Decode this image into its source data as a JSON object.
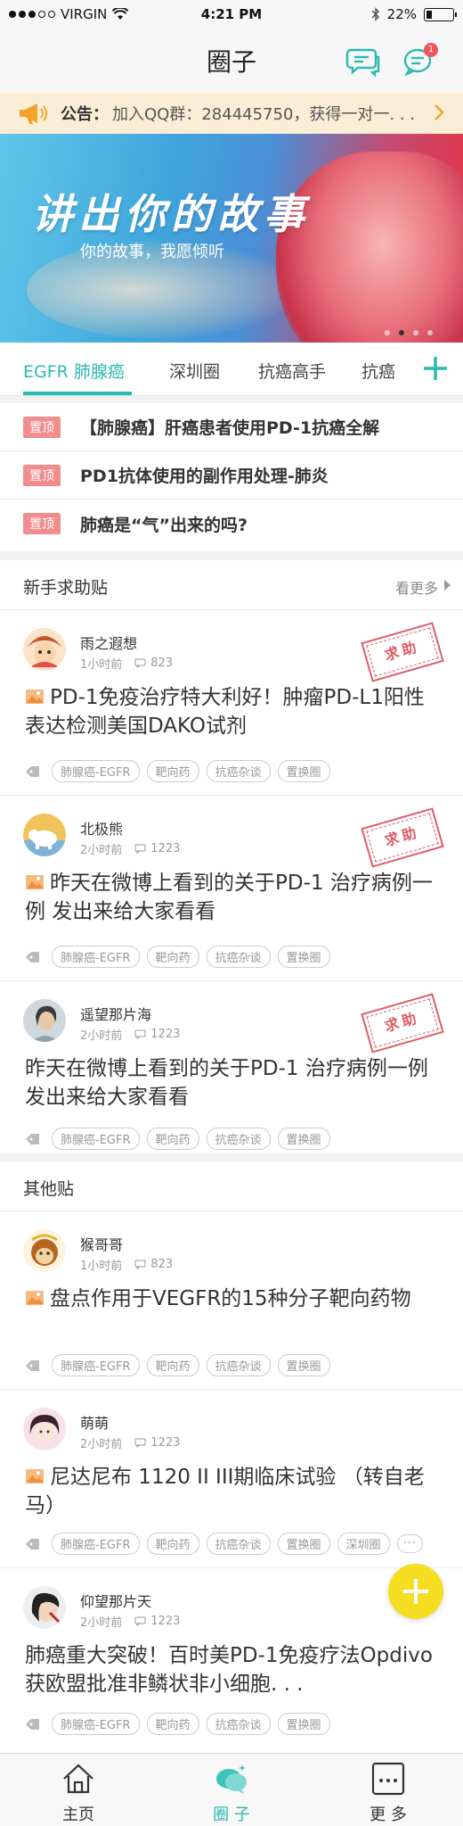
{
  "status": {
    "carrier": "VIRGIN",
    "time": "4:21 PM",
    "battery": "22%"
  },
  "nav": {
    "title": "圈子",
    "message_badge": "1"
  },
  "notice": {
    "label": "公告：",
    "text": "加入QQ群：284445750，获得一对一. . ."
  },
  "banner": {
    "headline": "讲出你的故事",
    "subtitle": "你的故事，我愿倾听"
  },
  "tabs": [
    "EGFR 肺腺癌",
    "深圳圈",
    "抗癌高手",
    "抗癌"
  ],
  "pinned": {
    "tag": "置顶",
    "items": [
      "【肺腺癌】肝癌患者使用PD-1抗癌全解",
      "PD1抗体使用的副作用处理-肺炎",
      "肺癌是“气”出来的吗?"
    ]
  },
  "newbie": {
    "title": "新手求助贴",
    "more": "看更多",
    "stamp": "求助",
    "posts": [
      {
        "user": "雨之遐想",
        "time": "1小时前",
        "comments": "823",
        "title": "PD-1免疫治疗特大利好！肿瘤PD-L1阳性表达检测美国DAKO试剂",
        "tags": [
          "肺腺癌-EGFR",
          "靶向药",
          "抗癌杂谈",
          "置换圈"
        ]
      },
      {
        "user": "北极熊",
        "time": "2小时前",
        "comments": "1223",
        "title": "昨天在微博上看到的关于PD-1 治疗病例一例 发出来给大家看看",
        "tags": [
          "肺腺癌-EGFR",
          "靶向药",
          "抗癌杂谈",
          "置换圈"
        ]
      },
      {
        "user": "遥望那片海",
        "time": "2小时前",
        "comments": "1223",
        "title": "昨天在微博上看到的关于PD-1 治疗病例一例 发出来给大家看看",
        "tags": [
          "肺腺癌-EGFR",
          "靶向药",
          "抗癌杂谈",
          "置换圈"
        ]
      }
    ]
  },
  "others": {
    "title": "其他贴",
    "posts": [
      {
        "user": "猴哥哥",
        "time": "1小时前",
        "comments": "823",
        "title": "盘点作用于VEGFR的15种分子靶向药物",
        "tags": [
          "肺腺癌-EGFR",
          "靶向药",
          "抗癌杂谈",
          "置换圈"
        ]
      },
      {
        "user": "萌萌",
        "time": "2小时前",
        "comments": "1223",
        "title": "尼达尼布 1120 II III期临床试验 （转自老马）",
        "tags": [
          "肺腺癌-EGFR",
          "靶向药",
          "抗癌杂谈",
          "置换圈",
          "深圳圈"
        ],
        "more_tag": "···"
      },
      {
        "user": "仰望那片天",
        "time": "2小时前",
        "comments": "1223",
        "title": "肺癌重大突破！百时美PD-1免疫疗法Opdivo获欧盟批准非鳞状非小细胞. . .",
        "tags": [
          "肺腺癌-EGFR",
          "靶向药",
          "抗癌杂谈",
          "置换圈"
        ]
      }
    ]
  },
  "tabbar": {
    "home": "主页",
    "circle": "圈 子",
    "more": "更 多"
  },
  "colors": {
    "accent": "#2bbab1",
    "pin": "#f28d8d",
    "fab": "#f5de22",
    "stamp": "#e15b66"
  }
}
